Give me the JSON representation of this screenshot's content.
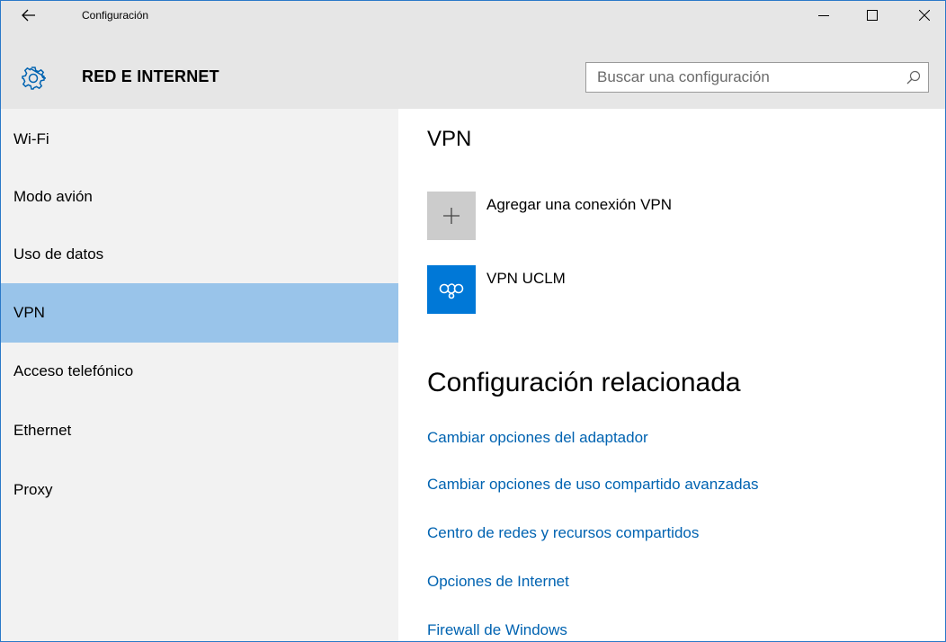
{
  "window": {
    "title": "Configuración",
    "back_icon": "back-arrow-icon",
    "controls": [
      "minimize-icon",
      "maximize-icon",
      "close-icon"
    ]
  },
  "header": {
    "icon": "gear-icon",
    "title": "RED E INTERNET",
    "search": {
      "placeholder": "Buscar una configuración",
      "value": "",
      "icon": "search-icon"
    }
  },
  "sidebar": {
    "items": [
      {
        "label": "Wi-Fi",
        "active": false
      },
      {
        "label": "Modo avión",
        "active": false
      },
      {
        "label": "Uso de datos",
        "active": false
      },
      {
        "label": "VPN",
        "active": true
      },
      {
        "label": "Acceso telefónico",
        "active": false
      },
      {
        "label": "Ethernet",
        "active": false
      },
      {
        "label": "Proxy",
        "active": false
      }
    ]
  },
  "main": {
    "title": "VPN",
    "add_vpn": {
      "label": "Agregar una conexión VPN",
      "icon": "plus-icon"
    },
    "connections": [
      {
        "label": "VPN UCLM",
        "icon": "vpn-connection-icon"
      }
    ],
    "related": {
      "title": "Configuración relacionada",
      "links": [
        "Cambiar opciones del adaptador",
        "Cambiar opciones de uso compartido avanzadas",
        "Centro de redes y recursos compartidos",
        "Opciones de Internet",
        "Firewall de Windows"
      ]
    }
  },
  "colors": {
    "accent": "#0078d7",
    "link": "#0063b1",
    "selected": "#99c4ea",
    "chrome": "#e6e6e6",
    "sidebar": "#f2f2f2"
  }
}
